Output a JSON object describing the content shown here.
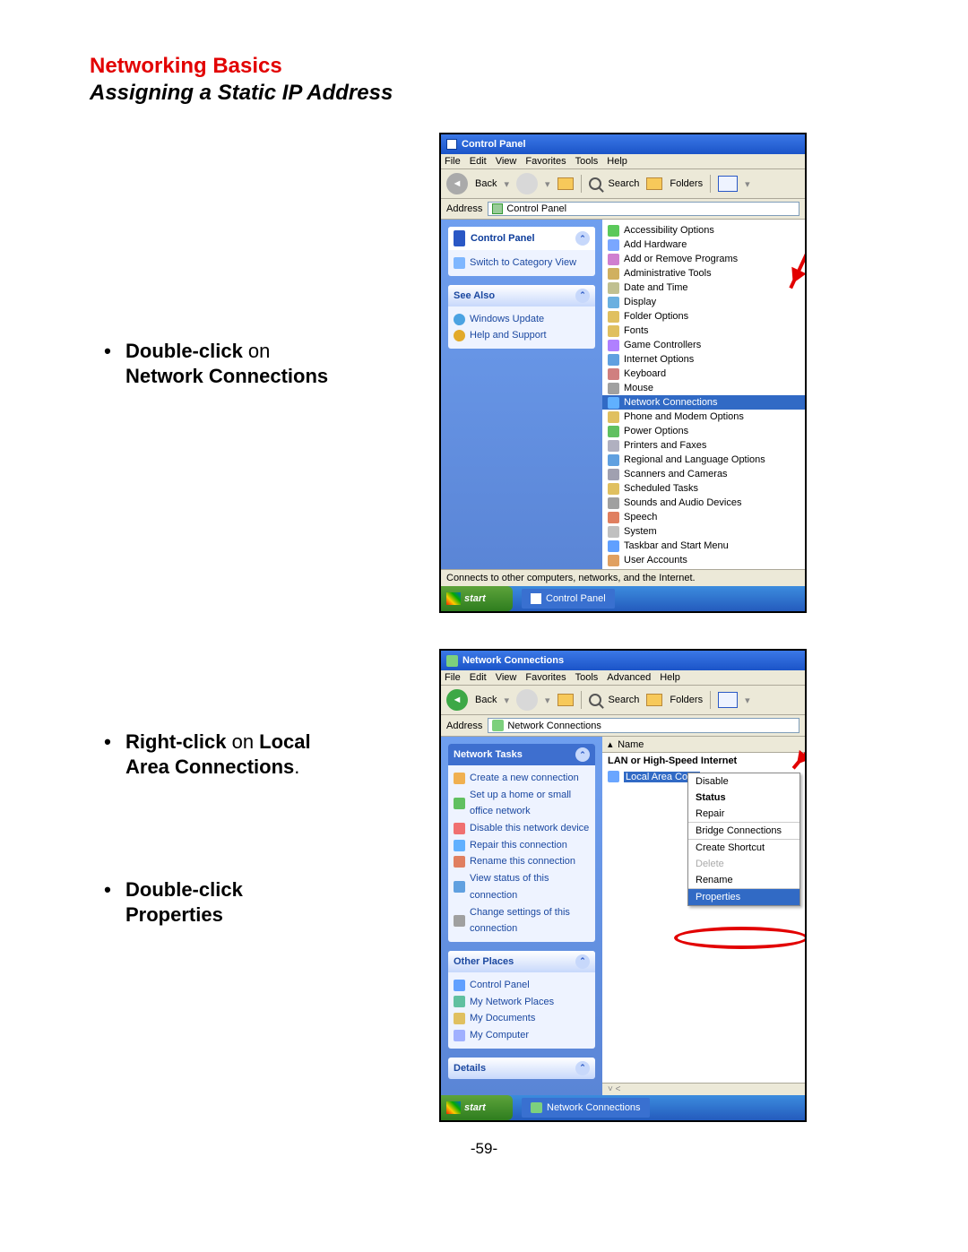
{
  "header": {
    "title": "Networking Basics",
    "subtitle": "Assigning a Static IP Address"
  },
  "bullets": {
    "b1_bold": "Double-click",
    "b1_rest": " on",
    "b1_line2": "Network Connections",
    "b2_bold": "Right-click",
    "b2_rest": " on ",
    "b2_bold2": "Local",
    "b2_line2": "Area Connections",
    "b3_bold": "Double-click",
    "b3_line2": "Properties"
  },
  "shot1": {
    "title": "Control Panel",
    "menu": [
      "File",
      "Edit",
      "View",
      "Favorites",
      "Tools",
      "Help"
    ],
    "back": "Back",
    "search": "Search",
    "folders": "Folders",
    "address_label": "Address",
    "address_path": "Control Panel",
    "cp_panel": "Control Panel",
    "switch": "Switch to Category View",
    "seealso": "See Also",
    "wu": "Windows Update",
    "hs": "Help and Support",
    "items": [
      "Accessibility Options",
      "Add Hardware",
      "Add or Remove Programs",
      "Administrative Tools",
      "Date and Time",
      "Display",
      "Folder Options",
      "Fonts",
      "Game Controllers",
      "Internet Options",
      "Keyboard",
      "Mouse",
      "Network Connections",
      "Phone and Modem Options",
      "Power Options",
      "Printers and Faxes",
      "Regional and Language Options",
      "Scanners and Cameras",
      "Scheduled Tasks",
      "Sounds and Audio Devices",
      "Speech",
      "System",
      "Taskbar and Start Menu",
      "User Accounts"
    ],
    "selected_index": 12,
    "status": "Connects to other computers, networks, and the Internet.",
    "start": "start",
    "task": "Control Panel"
  },
  "shot2": {
    "title": "Network Connections",
    "menu": [
      "File",
      "Edit",
      "View",
      "Favorites",
      "Tools",
      "Advanced",
      "Help"
    ],
    "back": "Back",
    "search": "Search",
    "folders": "Folders",
    "address_label": "Address",
    "address_path": "Network Connections",
    "tasks_h": "Network Tasks",
    "tasks": [
      "Create a new connection",
      "Set up a home or small office network",
      "Disable this network device",
      "Repair this connection",
      "Rename this connection",
      "View status of this connection",
      "Change settings of this connection"
    ],
    "other_h": "Other Places",
    "other": [
      "Control Panel",
      "My Network Places",
      "My Documents",
      "My Computer"
    ],
    "details_h": "Details",
    "col_name": "Name",
    "cat": "LAN or High-Speed Internet",
    "lan": "Local Area Conn",
    "ctx": [
      "Disable",
      "Status",
      "Repair",
      "Bridge Connections",
      "Create Shortcut",
      "Delete",
      "Rename",
      "Properties"
    ],
    "start": "start",
    "task": "Network Connections"
  },
  "pagenum": "-59-"
}
